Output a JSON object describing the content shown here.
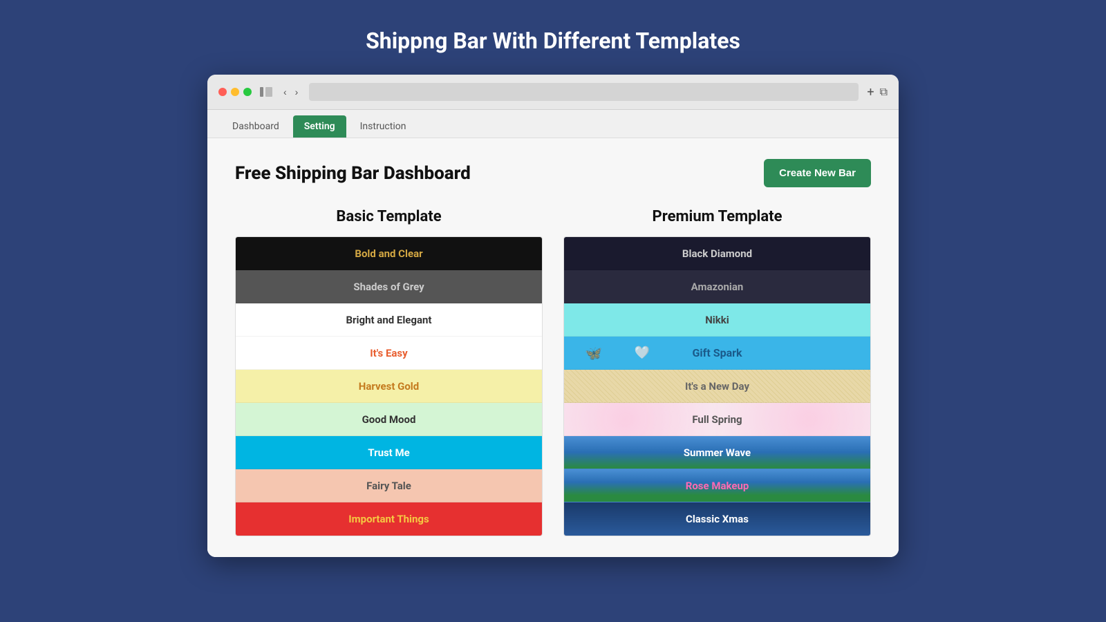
{
  "page": {
    "title": "Shippng Bar With Different Templates"
  },
  "browser": {
    "address_placeholder": ""
  },
  "tabs": {
    "dashboard": "Dashboard",
    "setting": "Setting",
    "instruction": "Instruction"
  },
  "dashboard": {
    "title": "Free Shipping Bar Dashboard",
    "create_btn": "Create New Bar",
    "basic_template_heading": "Basic Template",
    "premium_template_heading": "Premium Template"
  },
  "basic_templates": [
    {
      "label": "Bold and Clear",
      "class": "row-bold-clear"
    },
    {
      "label": "Shades of Grey",
      "class": "row-shades-grey"
    },
    {
      "label": "Bright and Elegant",
      "class": "row-bright-elegant"
    },
    {
      "label": "It's Easy",
      "class": "row-its-easy"
    },
    {
      "label": "Harvest Gold",
      "class": "row-harvest-gold"
    },
    {
      "label": "Good Mood",
      "class": "row-good-mood"
    },
    {
      "label": "Trust Me",
      "class": "row-trust-me"
    },
    {
      "label": "Fairy Tale",
      "class": "row-fairy-tale"
    },
    {
      "label": "Important Things",
      "class": "row-important-things"
    }
  ],
  "premium_templates": [
    {
      "label": "Black Diamond",
      "class": "row-black-diamond"
    },
    {
      "label": "Amazonian",
      "class": "row-amazonian"
    },
    {
      "label": "Nikki",
      "class": "row-nikki"
    },
    {
      "label": "Gift Spark",
      "class": "row-gift-spark",
      "has_icon": true
    },
    {
      "label": "It's a New Day",
      "class": "row-its-new-day"
    },
    {
      "label": "Full Spring",
      "class": "row-full-spring"
    },
    {
      "label": "Summer Wave",
      "class": "row-summer-wave"
    },
    {
      "label": "Rose Makeup",
      "class": "row-rose-makeup"
    },
    {
      "label": "Classic Xmas",
      "class": "row-classic-xmas"
    }
  ]
}
